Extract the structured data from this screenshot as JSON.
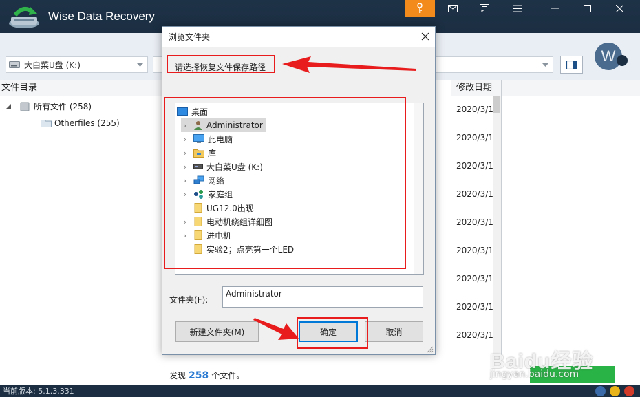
{
  "app": {
    "title": "Wise Data Recovery",
    "accent_color": "#f28a1c",
    "titlebar_color": "#1b2e42"
  },
  "titlebar": {
    "icons": [
      "key-icon",
      "mail-icon",
      "chat-icon",
      "menu-icon",
      "minimize-icon",
      "maximize-icon",
      "close-icon"
    ]
  },
  "toolbar": {
    "drive_label": "大白菜U盘 (K:)",
    "avatar_letter": "W"
  },
  "left_panel": {
    "header": "文件目录",
    "items": [
      {
        "label": "所有文件 (258)"
      },
      {
        "label": "Otherfiles (255)"
      }
    ]
  },
  "right_panel": {
    "header": "修改日期",
    "dates": [
      "2020/3/1",
      "2020/3/1",
      "2020/3/1",
      "2020/3/1",
      "2020/3/1",
      "2020/3/1",
      "2020/3/1",
      "2020/3/1",
      "2020/3/1"
    ]
  },
  "footer": {
    "found_prefix": "发现",
    "found_count": "258",
    "found_suffix": "个文件。",
    "version": "当前版本: 5.1.3.331"
  },
  "dialog": {
    "title": "浏览文件夹",
    "description": "请选择恢复文件保存路径",
    "folders": [
      {
        "label": "桌面",
        "icon": "desktop-icon",
        "chevron": false,
        "selected": false
      },
      {
        "label": "Administrator",
        "icon": "user-icon",
        "chevron": true,
        "selected": true
      },
      {
        "label": "此电脑",
        "icon": "computer-icon",
        "chevron": true,
        "selected": false
      },
      {
        "label": "库",
        "icon": "library-icon",
        "chevron": true,
        "selected": false
      },
      {
        "label": "大白菜U盘 (K:)",
        "icon": "usb-drive-icon",
        "chevron": true,
        "selected": false
      },
      {
        "label": "网络",
        "icon": "network-icon",
        "chevron": true,
        "selected": false
      },
      {
        "label": "家庭组",
        "icon": "homegroup-icon",
        "chevron": true,
        "selected": false
      },
      {
        "label": "UG12.0出现",
        "icon": "folder-icon",
        "chevron": false,
        "selected": false
      },
      {
        "label": "电动机绕组详细图",
        "icon": "folder-icon",
        "chevron": true,
        "selected": false
      },
      {
        "label": "进电机",
        "icon": "folder-icon",
        "chevron": true,
        "selected": false
      },
      {
        "label": "实验2；点亮第一个LED",
        "icon": "folder-icon",
        "chevron": false,
        "selected": false
      }
    ],
    "folder_label": "文件夹(F):",
    "folder_value": "Administrator",
    "new_folder_button": "新建文件夹(M)",
    "ok_button": "确定",
    "cancel_button": "取消"
  },
  "watermark": {
    "text": "Baidu经验",
    "sub": "jingyan.baidu.com"
  }
}
